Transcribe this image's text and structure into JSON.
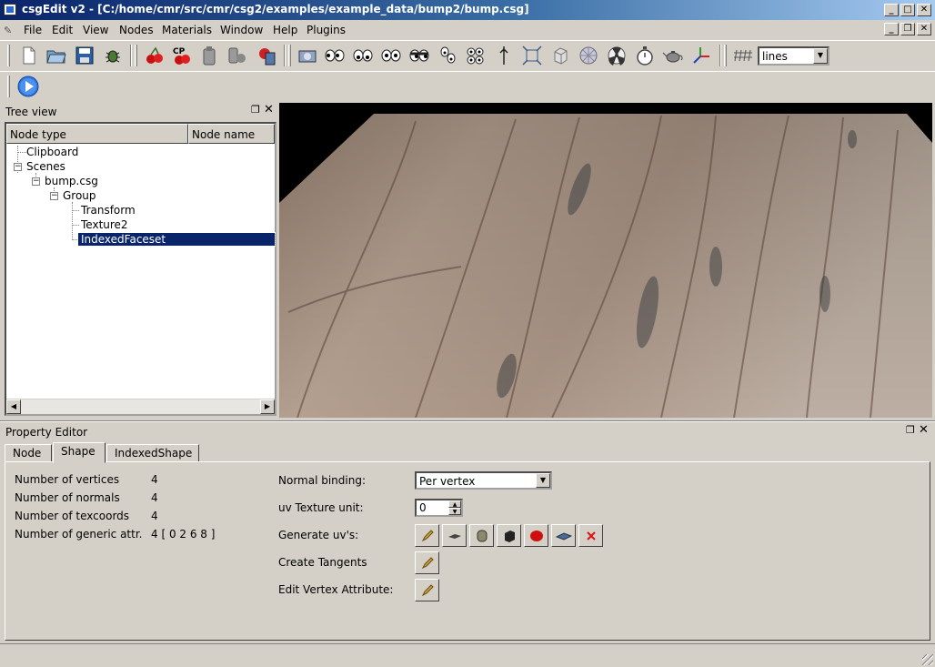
{
  "window": {
    "title": "csgEdit v2 - [C:/home/cmr/src/cmr/csg2/examples/example_data/bump2/bump.csg]",
    "minimize_glyph": "_",
    "maximize_glyph": "□",
    "close_glyph": "✕",
    "restore_glyph": "❐"
  },
  "menubar": {
    "items": [
      "File",
      "Edit",
      "View",
      "Nodes",
      "Materials",
      "Window",
      "Help",
      "Plugins"
    ]
  },
  "toolbar": {
    "render_mode": "lines",
    "icons": [
      "new-file-icon",
      "open-file-icon",
      "save-icon",
      "bug-icon",
      "cherries-icon",
      "copy-cherries-icon",
      "paste-icon",
      "paste-special-icon",
      "delete-icon",
      "camera-icon",
      "eyes-icon",
      "eyes-front-icon",
      "eyes-top-icon",
      "eyes-side-icon",
      "eyes-rotate-icon",
      "eyes-multi-icon",
      "pointer-icon",
      "fit-view-icon",
      "wire-cube-icon",
      "sphere-grid-icon",
      "radiation-icon",
      "stopwatch-icon",
      "teapot-icon",
      "axes-icon",
      "grid-icon",
      "play-icon"
    ]
  },
  "tree_view": {
    "title": "Tree view",
    "columns": [
      "Node type",
      "Node name"
    ],
    "nodes": [
      "Clipboard",
      "Scenes",
      "bump.csg",
      "Group",
      "Transform",
      "Texture2",
      "IndexedFaceset"
    ]
  },
  "property_editor": {
    "title": "Property Editor",
    "tabs": [
      "Node",
      "Shape",
      "IndexedShape"
    ],
    "active_tab": "Shape",
    "stats": [
      {
        "label": "Number of vertices",
        "value": "4"
      },
      {
        "label": "Number of normals",
        "value": "4"
      },
      {
        "label": "Number of texcoords",
        "value": "4"
      },
      {
        "label": "Number of generic attr.",
        "value": "4 [ 0 2 6 8 ]"
      }
    ],
    "normal_binding_label": "Normal binding:",
    "normal_binding_value": "Per vertex",
    "uv_texture_unit_label": "uv Texture unit:",
    "uv_texture_unit_value": "0",
    "generate_uvs_label": "Generate uv's:",
    "create_tangents_label": "Create Tangents",
    "edit_vertex_attr_label": "Edit Vertex Attribute:"
  },
  "colors": {
    "selection": "#0a246a",
    "face": "#d4d0c8"
  }
}
